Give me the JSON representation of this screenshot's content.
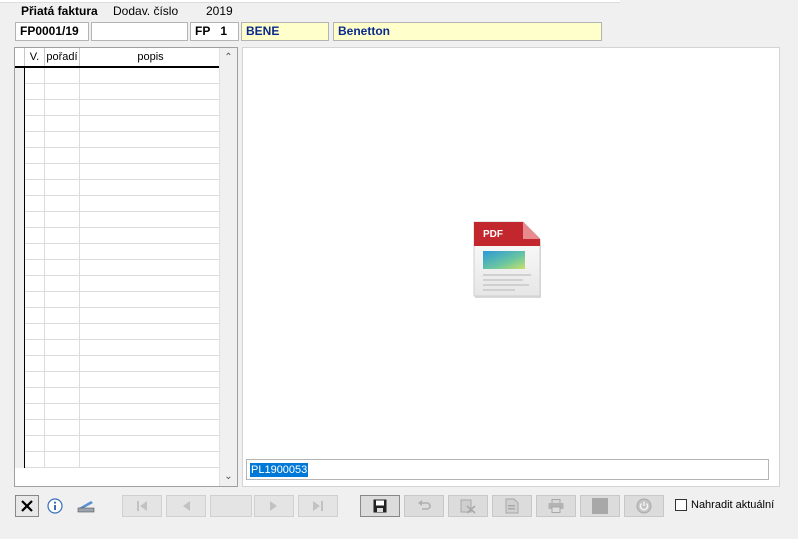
{
  "header": {
    "title": "Přiatá faktura",
    "supplier_no_label": "Dodav. číslo",
    "year": "2019"
  },
  "fields": {
    "doc_no": "FP0001/19",
    "supplier_no_value": "",
    "series": "FP",
    "series_no": "1",
    "partner_code": "BENE",
    "partner_name": "Benetton"
  },
  "grid": {
    "columns": [
      "V.",
      "pořadí",
      "popis"
    ]
  },
  "preview": {
    "pdf_label": "PDF",
    "file_name": "PL1900053"
  },
  "footer": {
    "replace_label": "Nahradit aktuální"
  },
  "icons": {
    "close": "close-icon",
    "info": "info-icon",
    "scan": "scanner-icon",
    "first": "first-icon",
    "prev": "prev-icon",
    "next": "next-icon",
    "last": "last-icon",
    "save": "save-icon",
    "undo": "undo-icon",
    "delete": "delete-icon",
    "doc": "document-icon",
    "print": "print-icon",
    "stop": "stop-icon",
    "power": "power-icon"
  }
}
